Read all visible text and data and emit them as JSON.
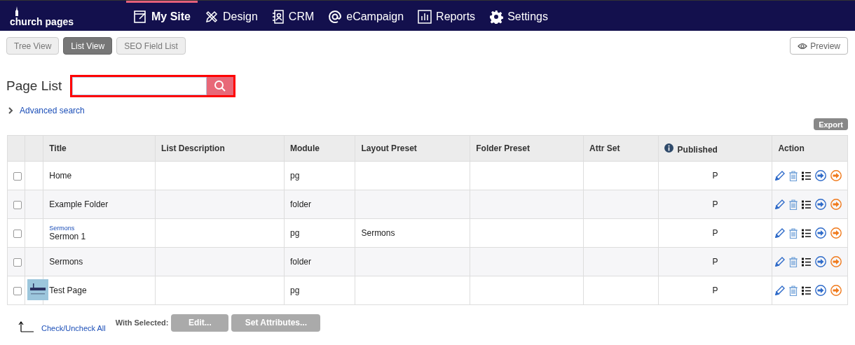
{
  "logo": "church pages",
  "nav": [
    {
      "label": "My Site",
      "selected": true
    },
    {
      "label": "Design",
      "selected": false
    },
    {
      "label": "CRM",
      "selected": false
    },
    {
      "label": "eCampaign",
      "selected": false
    },
    {
      "label": "Reports",
      "selected": false
    },
    {
      "label": "Settings",
      "selected": false
    }
  ],
  "view_tabs": [
    {
      "label": "Tree View",
      "selected": false
    },
    {
      "label": "List View",
      "selected": true
    },
    {
      "label": "SEO Field List",
      "selected": false
    }
  ],
  "preview_button": "Preview",
  "heading": "Page List",
  "search": {
    "highlighted": true
  },
  "advanced_search": "Advanced search",
  "export_button": "Export",
  "table": {
    "columns": [
      "Title",
      "List Description",
      "Module",
      "Layout Preset",
      "Folder Preset",
      "Attr Set",
      "Published",
      "Action"
    ],
    "rows": [
      {
        "checked": false,
        "title": "Home",
        "module": "pg",
        "published": "P"
      },
      {
        "checked": false,
        "title": "Example Folder",
        "module": "folder",
        "published": "P"
      },
      {
        "checked": false,
        "parent": "Sermons",
        "title": "Sermon 1",
        "module": "pg",
        "layout_preset": "Sermons",
        "published": "P"
      },
      {
        "checked": false,
        "title": "Sermons",
        "module": "folder",
        "published": "P"
      },
      {
        "checked": false,
        "title": "Test Page",
        "module": "pg",
        "published": "P"
      }
    ]
  },
  "check_all": "Check/Uncheck All",
  "with_selected": "With Selected:",
  "bulk_buttons": [
    "Edit...",
    "Set Attributes..."
  ]
}
